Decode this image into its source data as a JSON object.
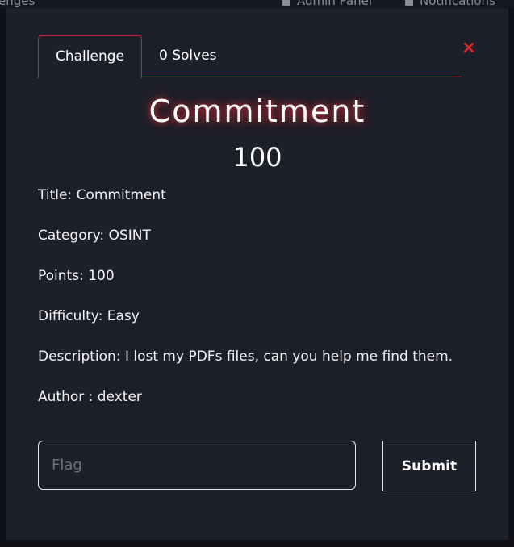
{
  "topbar": {
    "left_text": "enges",
    "admin_label": "Admin Panel",
    "notifications_label": "Notifications"
  },
  "modal": {
    "tabs": [
      {
        "label": "Challenge",
        "active": true
      },
      {
        "label": "0 Solves",
        "active": false
      }
    ],
    "close_icon": "×",
    "title": "Commitment",
    "points": "100",
    "description_lines": [
      "Title: Commitment",
      "Category: OSINT",
      "Points: 100",
      "Difficulty: Easy",
      "Description: I lost my PDFs files, can you help me find them.",
      "Author : dexter"
    ],
    "flag_input": {
      "placeholder": "Flag",
      "value": ""
    },
    "submit_label": "Submit"
  },
  "colors": {
    "accent": "#c0282d",
    "close": "#d7262b",
    "modal_bg": "#1d1f2a",
    "page_bg": "#0f1117"
  }
}
